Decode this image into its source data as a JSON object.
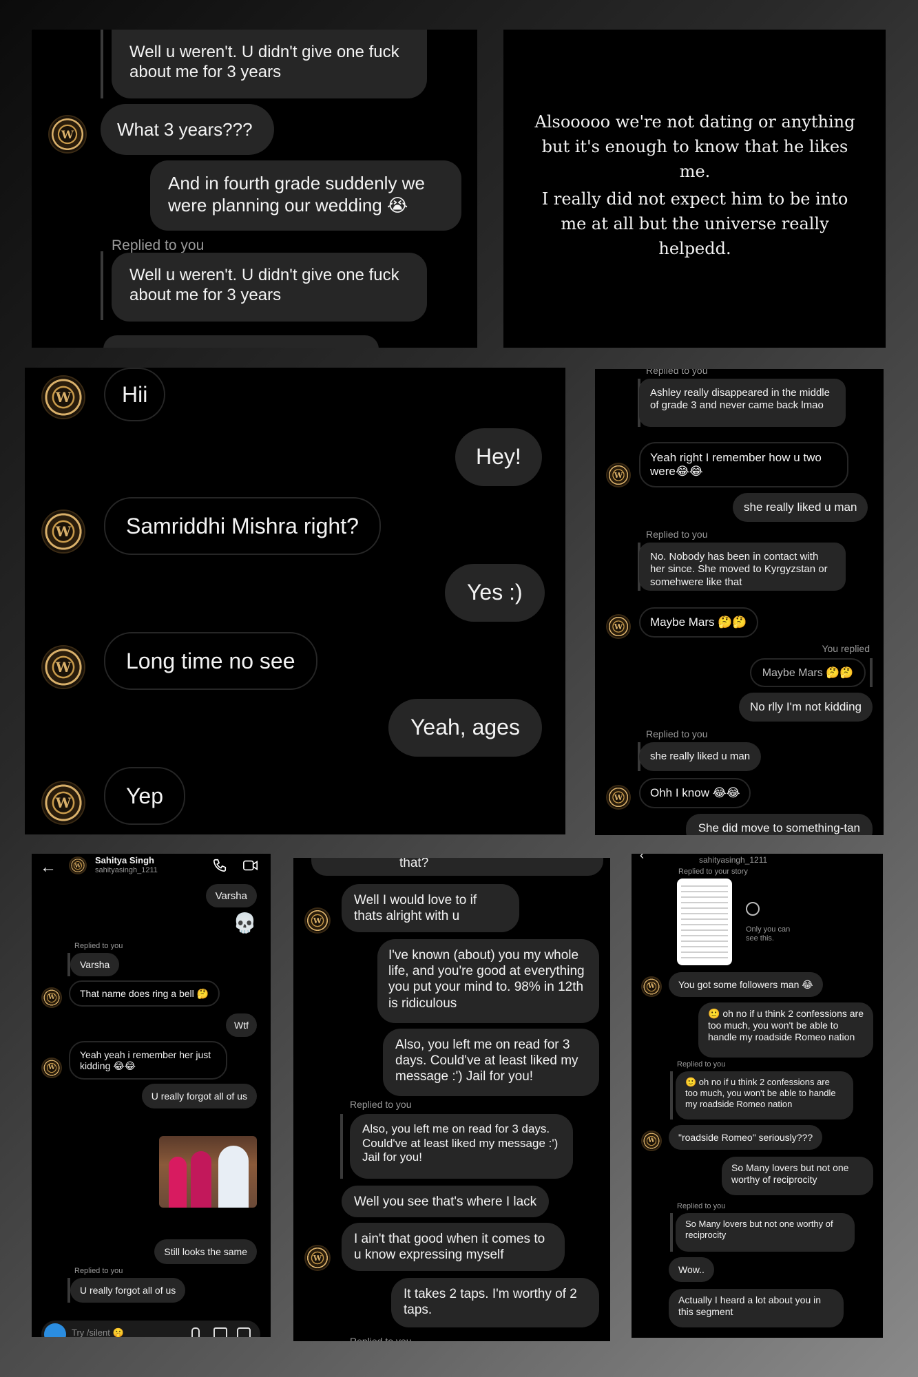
{
  "p1": {
    "reply1": "Well u weren't. U didn't give one fuck about me for 3 years",
    "m1": "What 3 years???",
    "m2": "And in fourth grade suddenly we were planning our wedding 😭",
    "replied_label": "Replied to you",
    "reply2": "Well u weren't. U didn't give one fuck about me for 3 years"
  },
  "p2": {
    "line1": "Alsooooo we're not dating or anything but it's enough to know that he likes me.",
    "line2": "I really did not expect him to be into me at all but the universe really helpedd."
  },
  "p3": {
    "m1": "Hii",
    "m2": "Hey!",
    "m3": "Samriddhi Mishra right?",
    "m4": "Yes :)",
    "m5": "Long time no see",
    "m6": "Yeah, ages",
    "m7": "Yep"
  },
  "p4": {
    "replied_top": "Replied to you",
    "reply1": "Ashley really disappeared in the middle of grade 3 and never came back lmao",
    "m1": "Yeah right I remember how u two were😂😂",
    "m2": "she really liked u man",
    "replied2": "Replied to you",
    "reply2": "No. Nobody has been in contact with her since. She moved to Kyrgyzstan or somehwere like that",
    "m3": "Maybe Mars 🤔🤔",
    "you_replied": "You replied",
    "reply3": "Maybe Mars 🤔🤔",
    "m4": "No rlly I'm not kidding",
    "replied3": "Replied to you",
    "reply4": "she really liked u man",
    "m5": "Ohh I know 😂😂",
    "m6": "She did move to something-tan"
  },
  "p5": {
    "name": "Sahitya Singh",
    "handle": "sahityasingh_1211",
    "m1": "Varsha",
    "skull": "💀",
    "replied1": "Replied to you",
    "reply1": "Varsha",
    "m2": "That name does ring a bell 🤔",
    "m3": "Wtf",
    "m4": "Yeah yeah i remember her just kidding 😂😂",
    "m5": "U really forgot all of us",
    "m6": "Still looks the same",
    "replied2": "Replied to you",
    "reply2": "U really forgot all of us",
    "input_placeholder": "Try /silent 🤫"
  },
  "p6": {
    "top": "that?",
    "m1": "Well I would love to if thats alright with u",
    "m2": "I've known (about) you my whole life, and you're good at everything you put your mind to. 98% in 12th is ridiculous",
    "m3": "Also, you left me on read for 3 days. Could've at least liked my message :') Jail for you!",
    "replied1": "Replied to you",
    "reply1": "Also, you left me on read for 3 days. Could've at least liked my message :') Jail for you!",
    "m4": "Well you see that's where I lack",
    "m5": "I ain't that good when it comes to u know expressing myself",
    "m6": "It takes 2 taps. I'm worthy of 2 taps.",
    "replied2": "Replied to you"
  },
  "p7": {
    "handle": "sahityasingh_1211",
    "story_label": "Replied to your story",
    "only_you": "Only you can see this.",
    "m1": "You got some followers man 😂",
    "m2": "🙂 oh no if u think 2 confessions are too much, you won't be able to handle my roadside Romeo nation",
    "replied1": "Replied to you",
    "reply1": "🙂 oh no if u think 2 confessions are too much, you won't be able to handle my roadside Romeo nation",
    "m3": "\"roadside Romeo\" seriously???",
    "m4": "So Many lovers but not one worthy of reciprocity",
    "replied2": "Replied to you",
    "reply2": "So Many lovers but not one worthy of reciprocity",
    "m5": "Wow..",
    "m6": "Actually I heard a lot about you in this segment"
  },
  "colors": {
    "bubble": "#262626",
    "panel": "#000000",
    "label": "#9a9a9a",
    "avatar_gold": "#d9b06a"
  }
}
